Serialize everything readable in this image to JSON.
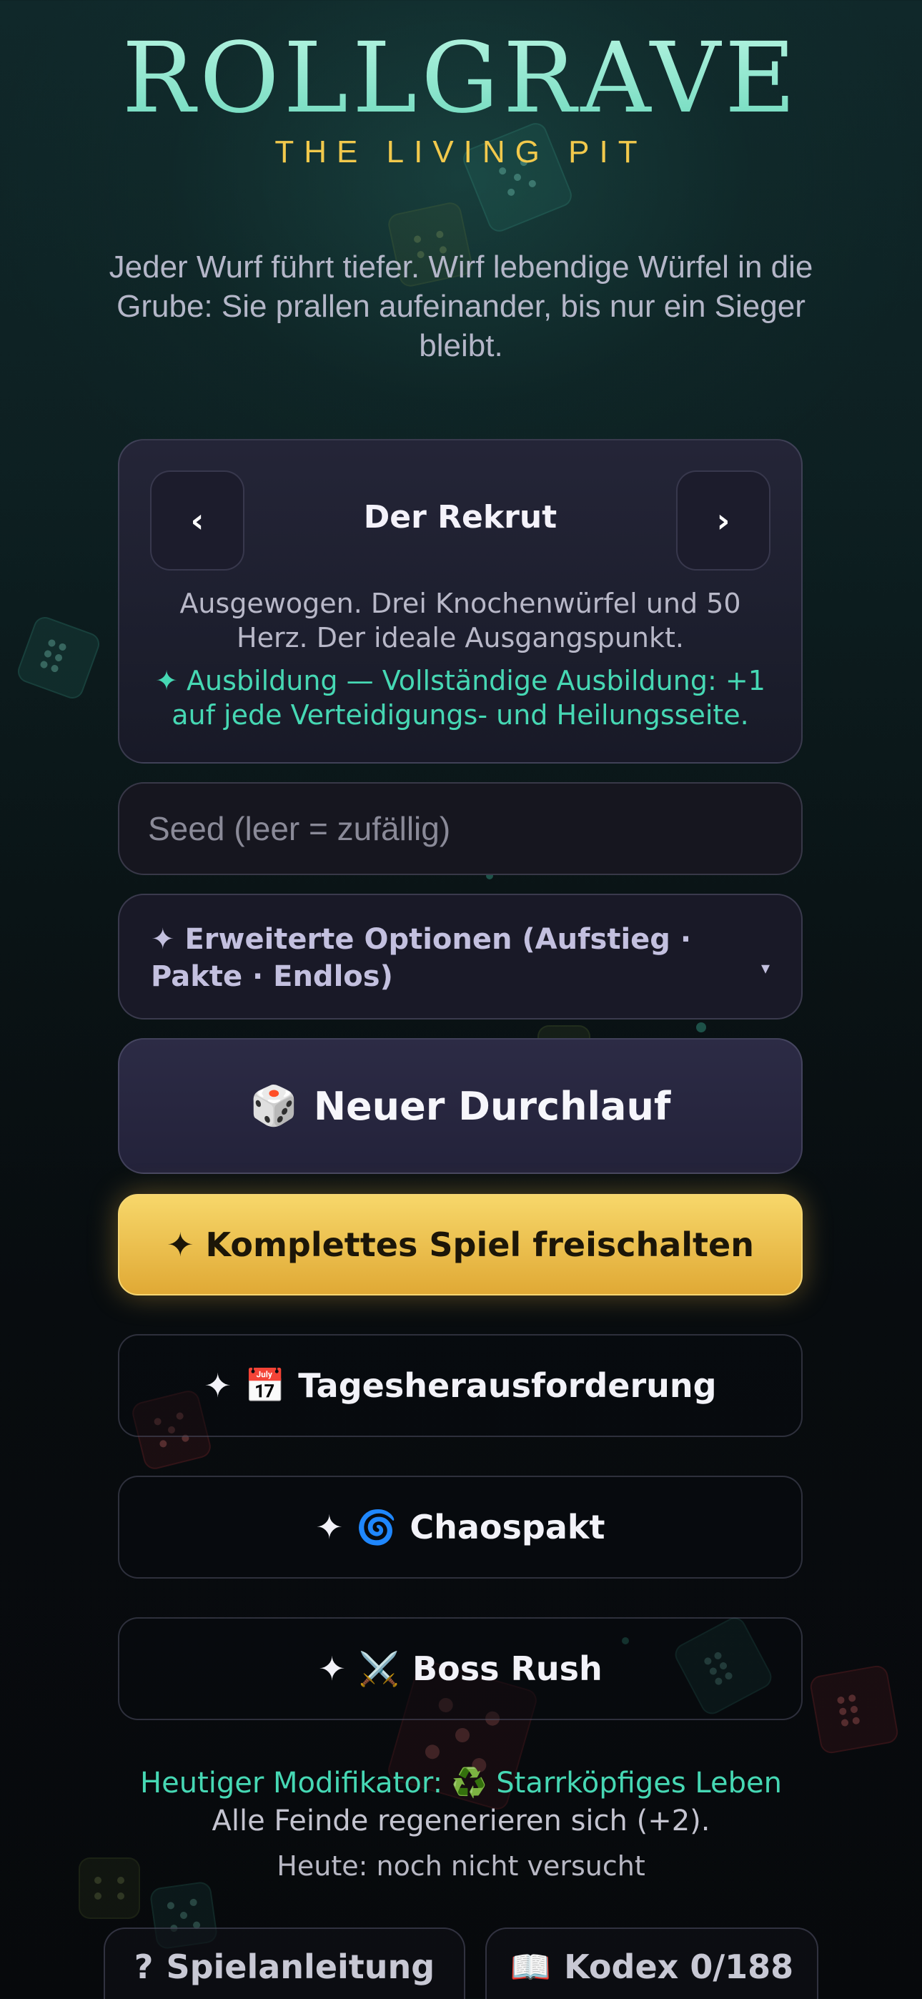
{
  "header": {
    "title": "ROLLGRAVE",
    "subtitle": "THE LIVING PIT",
    "tagline": "Jeder Wurf führt tiefer. Wirf lebendige Würfel in die Grube: Sie prallen aufeinander, bis nur ein Sieger bleibt."
  },
  "character": {
    "prev_label": "‹",
    "next_label": "›",
    "name": "Der Rekrut",
    "description": "Ausgewogen. Drei Knochenwürfel und 50 Herz. Der ideale Ausgangspunkt.",
    "perk": "✦ Ausbildung — Vollständige Ausbildung: +1 auf jede Verteidigungs- und Heilungsseite."
  },
  "seed": {
    "placeholder": "Seed (leer = zufällig)",
    "value": ""
  },
  "advanced_options": {
    "label": "✦ Erweiterte Optionen (Aufstieg · Pakte · Endlos)",
    "caret": "▾"
  },
  "actions": {
    "new_run": {
      "icon": "🎲",
      "label": "Neuer Durchlauf"
    },
    "unlock": {
      "icon": "✦",
      "label": "Komplettes Spiel freischalten"
    },
    "daily": {
      "star": "✦",
      "icon": "📅",
      "label": "Tagesherausforderung"
    },
    "chaos": {
      "star": "✦",
      "icon": "🌀",
      "label": "Chaospakt"
    },
    "boss": {
      "star": "✦",
      "icon": "⚔️",
      "label": "Boss Rush"
    }
  },
  "daily_modifier": {
    "label": "Heutiger Modifikator: ♻️ Starrköpfiges Leben",
    "description": "Alle Feinde regenerieren sich (+2).",
    "status": "Heute: noch nicht versucht"
  },
  "footer": {
    "help": {
      "icon": "?",
      "label": "Spielanleitung"
    },
    "codex": {
      "icon": "📖",
      "label": "Kodex 0/188"
    }
  },
  "colors": {
    "title": "#8ae6cf",
    "subtitle": "#f2c94c",
    "accent": "#46d8b4",
    "unlock_gold": "#f2c14a",
    "background": "#0a1416"
  }
}
